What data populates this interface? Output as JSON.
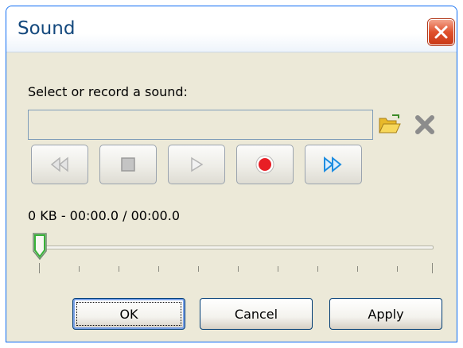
{
  "window": {
    "title": "Sound"
  },
  "content": {
    "prompt": "Select or record a sound:",
    "sound_input": {
      "value": "",
      "placeholder": ""
    },
    "status": "0 KB - 00:00.0 / 00:00.0",
    "position_fraction": 0
  },
  "icons": {
    "browse": "folder-icon",
    "remove": "delete-x-icon",
    "rewind": "rewind-icon",
    "stop": "stop-icon",
    "play": "play-icon",
    "record": "record-icon",
    "fast_forward": "fast-forward-icon"
  },
  "buttons": {
    "ok": "OK",
    "cancel": "Cancel",
    "apply": "Apply"
  },
  "colors": {
    "title_text": "#13487d",
    "record": "#e81e25",
    "fast_forward": "#1e8de0"
  }
}
